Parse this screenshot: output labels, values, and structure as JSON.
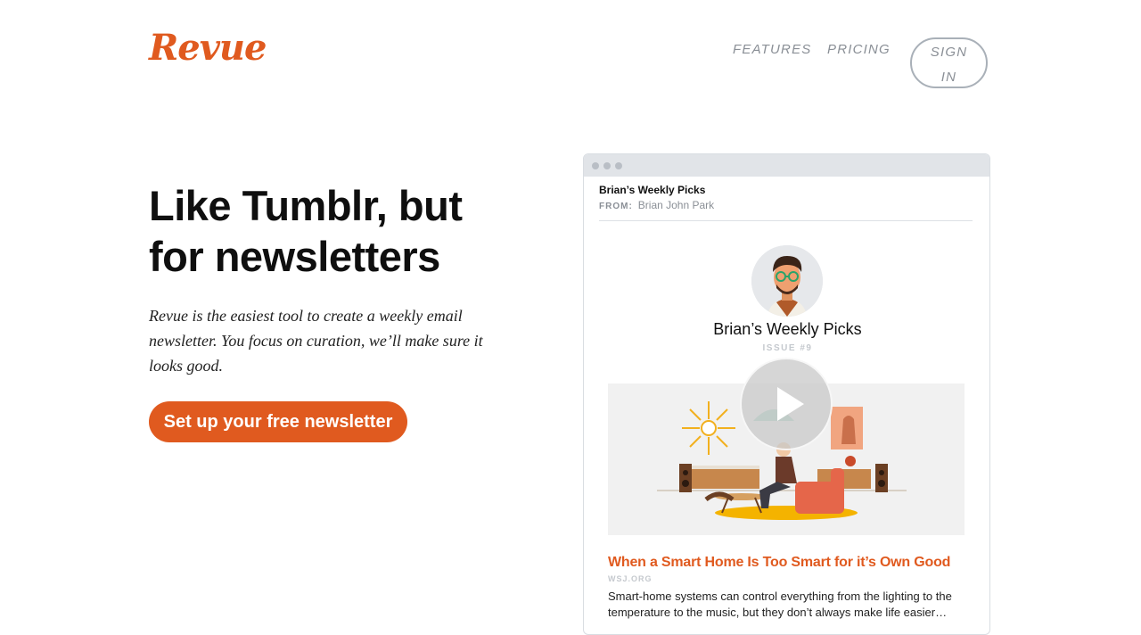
{
  "header": {
    "logo": "Revue",
    "nav": {
      "features": "FEATURES",
      "pricing": "PRICING"
    },
    "sign_in_line1": "SIGN",
    "sign_in_line2": "IN"
  },
  "hero": {
    "title": "Like Tumblr, but for newsletters",
    "description": "Revue is the easiest tool to create a weekly email newsletter. You focus on curation, we’ll make sure it looks good.",
    "cta": "Set up your free newsletter"
  },
  "preview": {
    "subject": "Brian’s Weekly Picks",
    "from_label": "FROM:",
    "from_name": "Brian John Park",
    "newsletter_title": "Brian’s Weekly Picks",
    "issue": "ISSUE #9",
    "article": {
      "title": "When a Smart Home Is Too Smart for it’s Own Good",
      "source": "WSJ.ORG",
      "excerpt": "Smart-home systems can control everything from the lighting to the temperature to the music, but they don’t always make life easier…"
    }
  },
  "colors": {
    "brand": "#e05a1f",
    "muted": "#8a8f96"
  }
}
